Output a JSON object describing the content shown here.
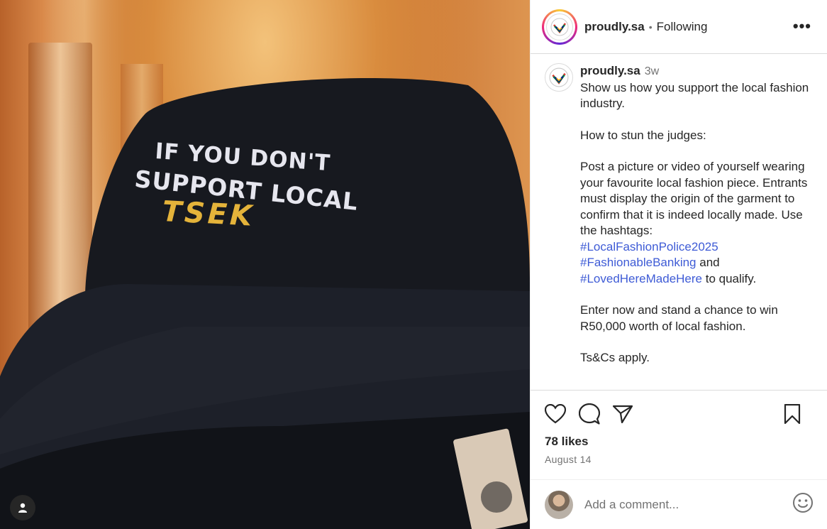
{
  "header": {
    "username": "proudly.sa",
    "separator": "•",
    "follow_status": "Following",
    "more": "•••"
  },
  "photo": {
    "hat_line_1": "IF YOU DON'T",
    "hat_line_2": "SUPPORT LOCAL",
    "hat_brand": "TSEK"
  },
  "caption": {
    "username": "proudly.sa",
    "time": "3w",
    "p1": "Show us how you support the local fashion industry.",
    "p2": "How to stun the judges:",
    "p3": "Post a picture or video of yourself wearing your favourite local fashion piece. Entrants must display the origin of the garment to confirm that it is indeed locally made. Use the hashtags:",
    "hashtag1": "#LocalFashionPolice2025",
    "hashtag2": "#FashionableBanking",
    "and": "and",
    "hashtag3": "#LovedHereMadeHere",
    "qualify": "to qualify.",
    "p4": "Enter now and stand a chance to win R50,000 worth of local fashion.",
    "p5": "Ts&Cs apply."
  },
  "actions": {
    "likes": "78 likes",
    "date": "August 14"
  },
  "comment": {
    "placeholder": "Add a comment..."
  },
  "icons": {
    "like": "heart-icon",
    "comment": "comment-bubble-icon",
    "share": "paper-plane-icon",
    "save": "bookmark-icon",
    "emoji": "smiley-icon",
    "tagged": "user-tag-icon"
  }
}
